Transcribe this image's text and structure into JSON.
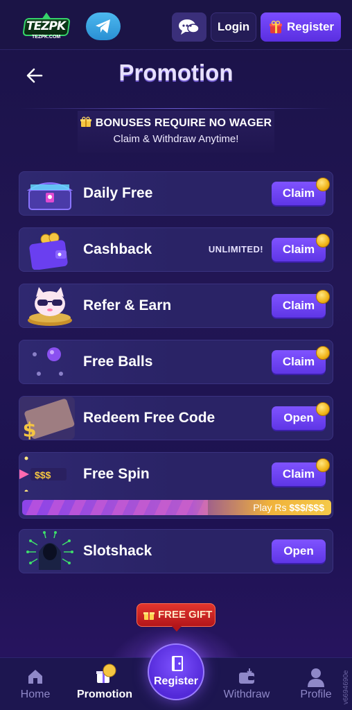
{
  "header": {
    "logo_text": "TEZPK",
    "logo_sub": "TEZPK.COM",
    "login_label": "Login",
    "register_label": "Register"
  },
  "page": {
    "title": "Promotion"
  },
  "bonus": {
    "headline": "BONUSES REQUIRE NO WAGER",
    "subline": "Claim & Withdraw Anytime!"
  },
  "promotions": [
    {
      "label": "Daily Free",
      "tag": "",
      "button": "Claim",
      "icon": "treasure-chest-icon"
    },
    {
      "label": "Cashback",
      "tag": "UNLIMITED!",
      "button": "Claim",
      "icon": "wallet-coins-icon"
    },
    {
      "label": "Refer & Earn",
      "tag": "",
      "button": "Claim",
      "icon": "cat-mascot-icon"
    },
    {
      "label": "Free Balls",
      "tag": "",
      "button": "Claim",
      "icon": "balls-icon"
    },
    {
      "label": "Redeem Free Code",
      "tag": "",
      "button": "Open",
      "icon": "ticket-icon"
    },
    {
      "label": "Free Spin",
      "tag": "",
      "button": "Claim",
      "icon": "spin-icon",
      "progress_text_prefix": "Play Rs ",
      "progress_text_value": "$$$/$$$",
      "progress": 0.6,
      "art_text": "$$$"
    },
    {
      "label": "Slotshack",
      "tag": "",
      "button": "Open",
      "icon": "hacker-icon"
    }
  ],
  "free_gift": {
    "label": "FREE GIFT"
  },
  "nav": {
    "home": "Home",
    "promotion": "Promotion",
    "register": "Register",
    "withdraw": "Withdraw",
    "profile": "Profile"
  },
  "version": "v6694690e",
  "colors": {
    "accent": "#6a40f5",
    "background": "#1e1552",
    "coin": "#f0b419",
    "gift_red": "#c8201f"
  }
}
